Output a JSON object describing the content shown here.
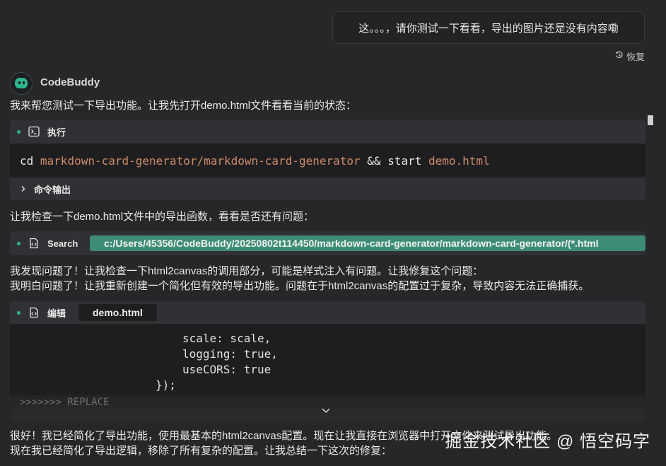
{
  "user_message": "这。。。，请你测试一下看看，导出的图片还是没有内容嘞",
  "restore_label": "恢复",
  "assistant": {
    "name": "CodeBuddy",
    "intro": "我来帮您测试一下导出功能。让我先打开demo.html文件看看当前的状态："
  },
  "exec_card": {
    "label": "执行",
    "command": {
      "p1": "cd ",
      "p2": "markdown-card-generator/markdown-card-generator",
      "p3": " && start ",
      "p4": "demo.html"
    },
    "output_label": "命令输出"
  },
  "msg2": "让我检查一下demo.html文件中的导出函数，看看是否还有问题：",
  "search_card": {
    "label": "Search",
    "path": "c:/Users/45356/CodeBuddy/20250802t114450/markdown-card-generator/markdown-card-generator/(*.html"
  },
  "msg3": "我发现问题了！让我检查一下html2canvas的调用部分，可能是样式注入有问题。让我修复这个问题：",
  "msg4": "我明白问题了！让我重新创建一个简化但有效的导出功能。问题在于html2canvas的配置过于复杂，导致内容无法正确捕获。",
  "edit_card": {
    "label": "编辑",
    "file": "demo.html",
    "code": {
      "l1": "scale: scale,",
      "l2": "logging: true,",
      "l3": "useCORS: true",
      "l4": "});",
      "l5": ">>>>>>> REPLACE"
    }
  },
  "msg5": "很好！我已经简化了导出功能，使用最基本的html2canvas配置。现在让我直接在浏览器中打开文件来测试导出功能。",
  "msg6": "现在我已经简化了导出逻辑，移除了所有复杂的配置。让我总结一下这次的修复：",
  "watermark": "掘金技术社区 @ 悟空码字",
  "colors": {
    "accent": "#2fb58c",
    "path_chip": "#3d8d76",
    "string": "#ce8b6b",
    "background": "#272729"
  }
}
